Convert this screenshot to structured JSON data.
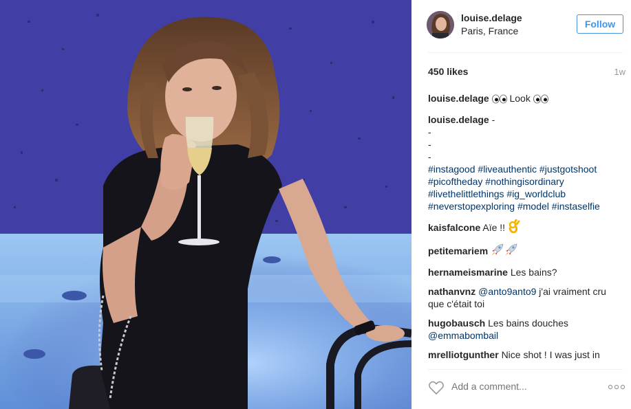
{
  "post": {
    "username": "louise.delage",
    "location": "Paris, France",
    "follow_label": "Follow",
    "likes": "450 likes",
    "time_ago": "1w"
  },
  "caption": {
    "user": "louise.delage",
    "text": "Look"
  },
  "caption2": {
    "user": "louise.delage",
    "lines": [
      "-",
      "-",
      "-",
      "-"
    ],
    "hashtags": [
      "#instagood",
      "#liveauthentic",
      "#justgotshoot",
      "#picoftheday",
      "#nothingisordinary",
      "#livethelittlethings",
      "#ig_worldclub",
      "#neverstopexploring",
      "#model",
      "#instaselfie"
    ]
  },
  "comments": [
    {
      "user": "kaisfalcone",
      "text": "Aïe !!"
    },
    {
      "user": "petitemariem",
      "text": ""
    },
    {
      "user": "hernameismarine",
      "text": "Les bains?"
    },
    {
      "user": "nathanvnz",
      "mention": "@anto9anto9",
      "text": "j'ai vraiment cru que c'était toi"
    },
    {
      "user": "hugobausch",
      "text": "Les bains douches",
      "mention": "@emmabombail"
    },
    {
      "user": "mrelliotgunther",
      "text": "Nice shot ! I was just in Paris a few days ago ! Posting some pics soon... might even move there lol"
    }
  ],
  "footer": {
    "add_comment_placeholder": "Add a comment..."
  },
  "icons": {
    "heart": "heart-icon",
    "more": "more-options-icon",
    "eyes": "eyes-emoji",
    "ok_hand": "ok-hand-emoji",
    "rocket": "rocket-emoji"
  },
  "colors": {
    "follow_border": "#4a90e2",
    "follow_text": "#3897f0",
    "hashtag": "#003569",
    "photo_wall": "#4a47b0",
    "pool_water": "#7fa8e6"
  }
}
